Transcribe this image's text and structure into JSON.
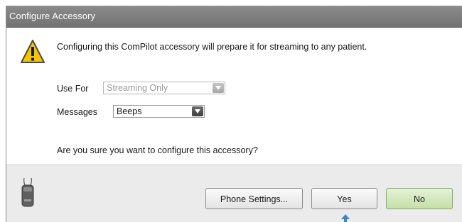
{
  "window": {
    "title": "Configure Accessory"
  },
  "message": {
    "text": "Configuring this ComPilot accessory will prepare it for streaming to any patient."
  },
  "use_for": {
    "label": "Use For",
    "value": "Streaming Only",
    "enabled": false
  },
  "messages": {
    "label": "Messages",
    "value": "Beeps",
    "enabled": true
  },
  "question": {
    "text": "Are you sure you want to configure this accessory?"
  },
  "buttons": {
    "phone_settings": "Phone Settings...",
    "yes": "Yes",
    "no": "No"
  },
  "icons": {
    "warning": "warning-icon",
    "device": "compilot-device-icon",
    "dropdown": "chevron-down-icon",
    "pointer": "mouse-pointer-icon"
  },
  "colors": {
    "titlebar": "#808080",
    "footer": "#ebebeb",
    "warning_fill": "#f5c400",
    "no_button": "#d4e9bd",
    "pointer": "#3b86c4"
  }
}
